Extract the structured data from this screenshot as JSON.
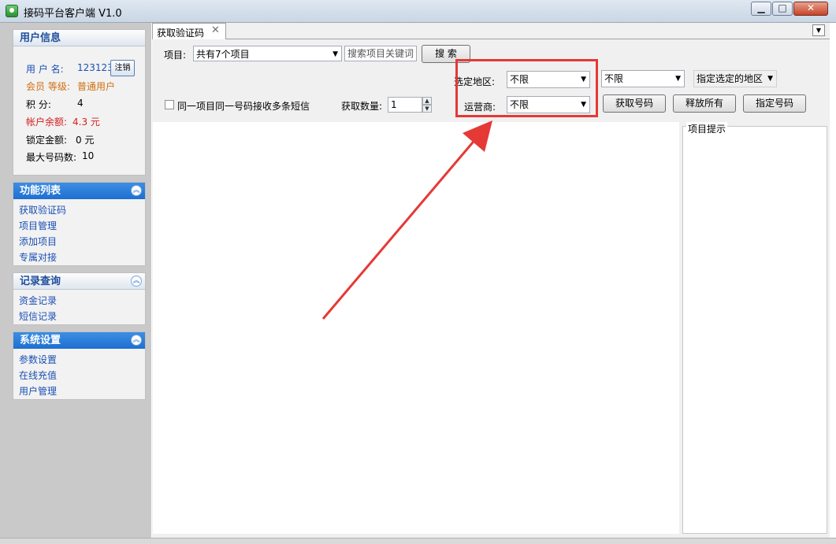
{
  "window": {
    "title": "接码平台客户端 V1.0",
    "minimize": "▁",
    "restore": "□",
    "close": "✕"
  },
  "user_info": {
    "header": "用户信息",
    "username_label": "用 户 名:",
    "username_value": "123123",
    "logout_button": "注销",
    "level_label": "会员 等级:",
    "level_value": "普通用户",
    "points_label": "积    分:",
    "points_value": "4",
    "balance_label": "帐户余额:",
    "balance_value": "4.3 元",
    "locked_label": "锁定金额:",
    "locked_value": "0 元",
    "max_numbers_label": "最大号码数:",
    "max_numbers_value": "10"
  },
  "function_list": {
    "header": "功能列表",
    "items": [
      "获取验证码",
      "项目管理",
      "添加项目",
      "专属对接"
    ]
  },
  "records": {
    "header": "记录查询",
    "items": [
      "资金记录",
      "短信记录"
    ]
  },
  "settings": {
    "header": "系统设置",
    "items": [
      "参数设置",
      "在线充值",
      "用户管理"
    ]
  },
  "tab": {
    "label": "获取验证码",
    "close_icon": "✕"
  },
  "form": {
    "project_label": "项目:",
    "project_value": "共有7个项目",
    "search_placeholder": "搜索项目关键词",
    "search_button": "搜 索",
    "region_label": "选定地区:",
    "region_value": "不限",
    "region2_value": "不限",
    "region_mode_value": "指定选定的地区",
    "carrier_label": "运营商:",
    "carrier_value": "不限",
    "multi_sms_label": "同一项目同一号码接收多条短信",
    "multi_sms_checked": false,
    "quantity_label": "获取数量:",
    "quantity_value": "1",
    "get_number_button": "获取号码",
    "release_all_button": "释放所有",
    "assign_number_button": "指定号码"
  },
  "hints": {
    "label": "项目提示"
  },
  "colors": {
    "panel_header": "#1e6fd0",
    "link": "#1a4fb4",
    "balance_red": "#d42020",
    "level_orange": "#d07010",
    "annotation_red": "#e53935"
  }
}
